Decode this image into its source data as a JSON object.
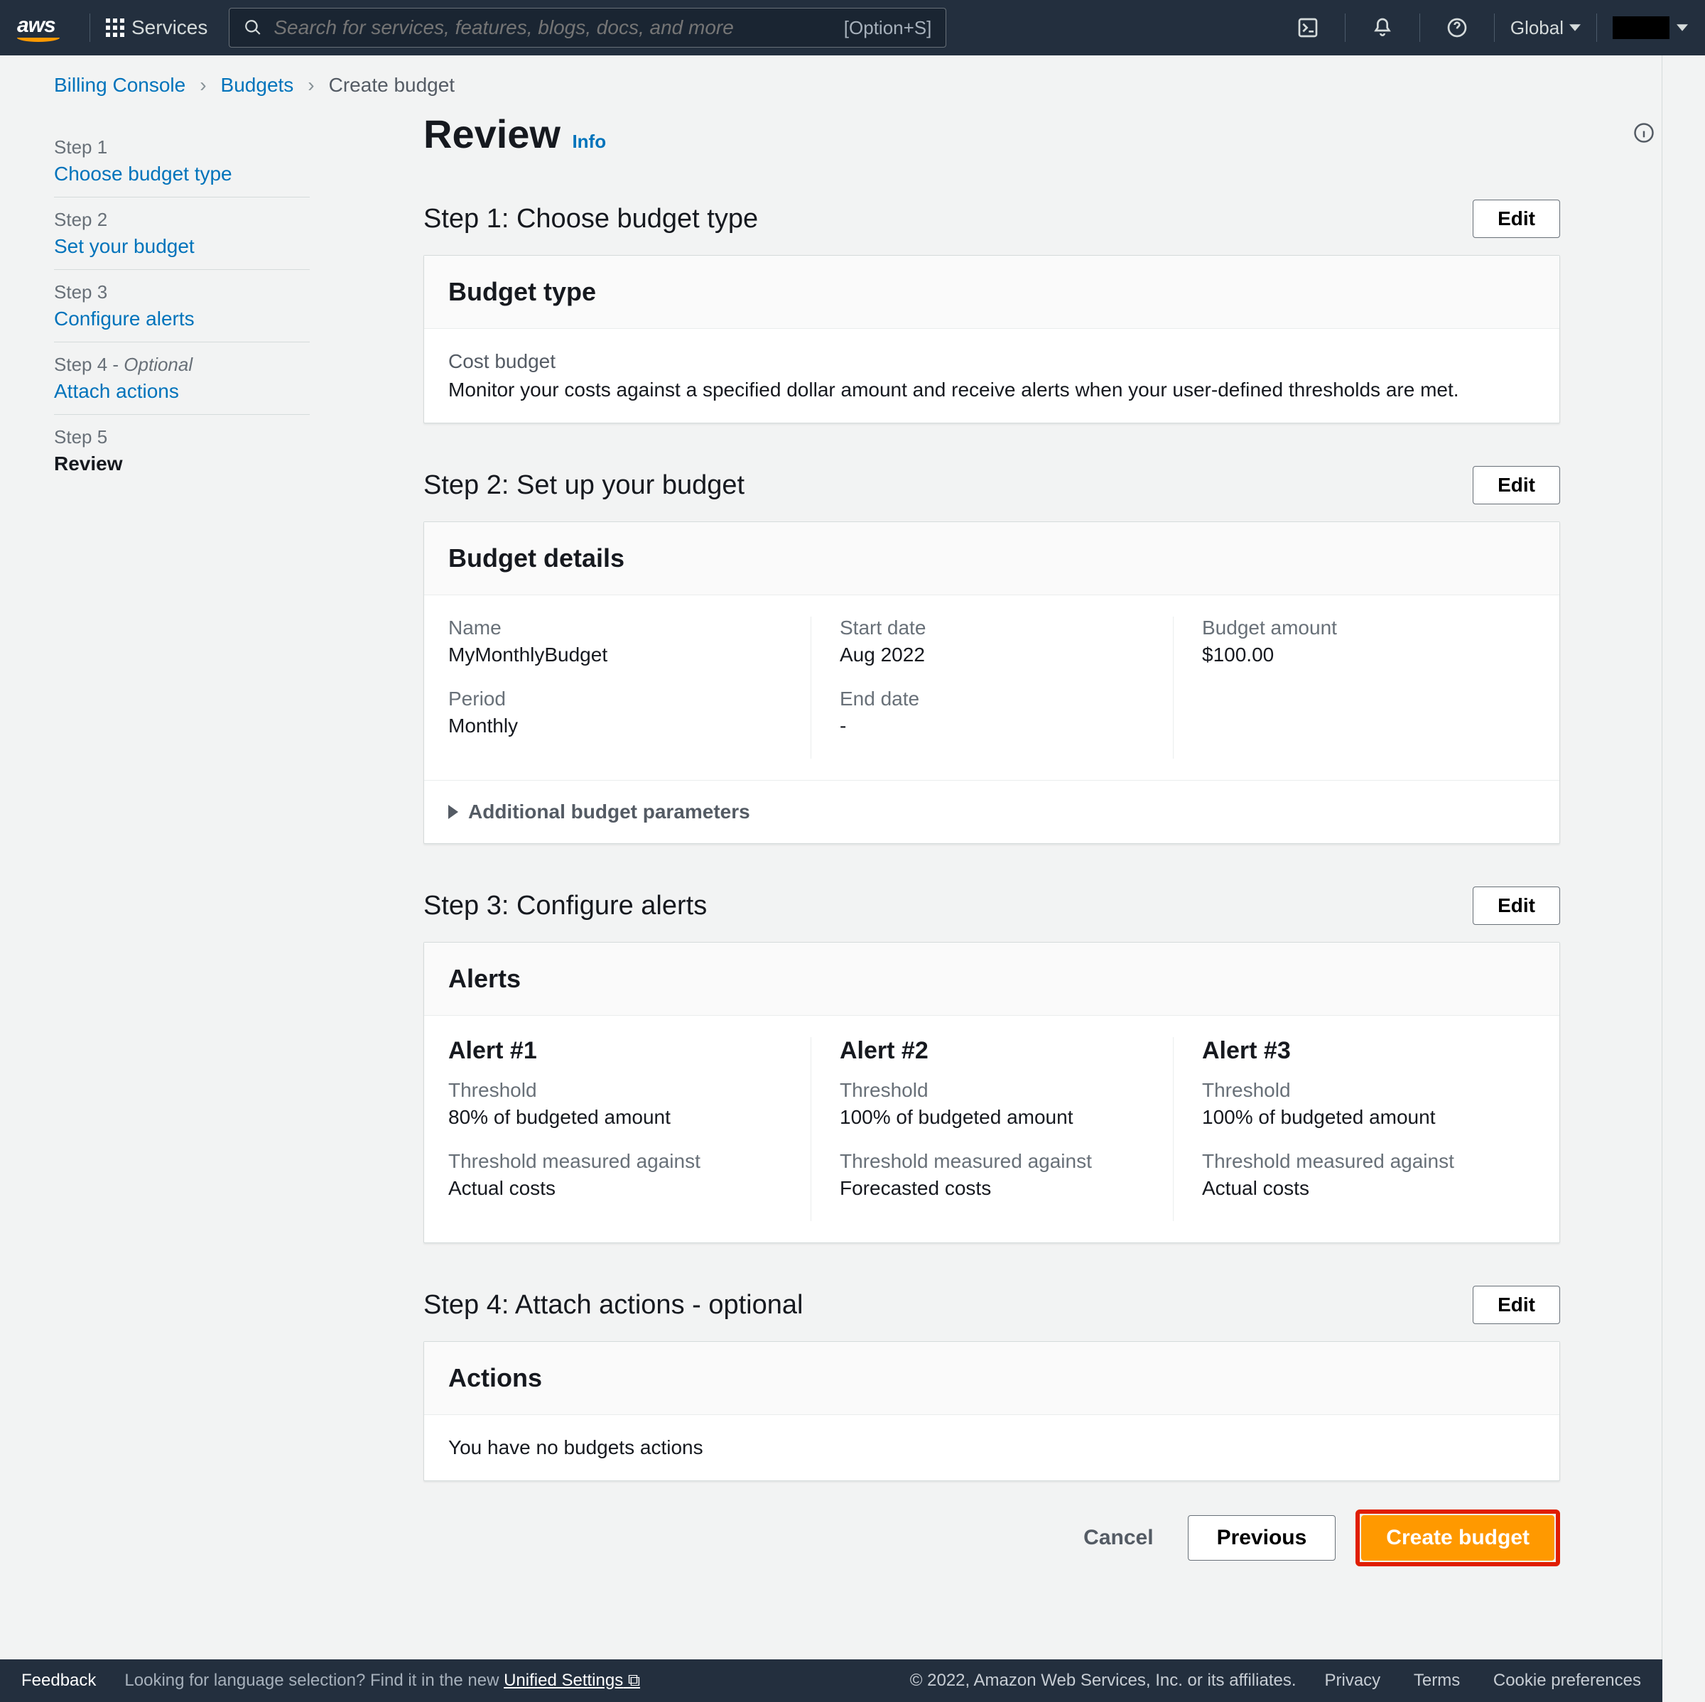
{
  "topnav": {
    "logo": "aws",
    "services": "Services",
    "search_placeholder": "Search for services, features, blogs, docs, and more",
    "search_shortcut": "[Option+S]",
    "region": "Global"
  },
  "breadcrumbs": {
    "a": "Billing Console",
    "b": "Budgets",
    "c": "Create budget"
  },
  "side_steps": [
    {
      "num": "Step 1",
      "title": "Choose budget type",
      "link": true
    },
    {
      "num": "Step 2",
      "title": "Set your budget",
      "link": true
    },
    {
      "num": "Step 3",
      "title": "Configure alerts",
      "link": true
    },
    {
      "num": "Step 4 - ",
      "optional": "Optional",
      "title": "Attach actions",
      "link": true
    },
    {
      "num": "Step 5",
      "title": "Review",
      "active": true
    }
  ],
  "page_title": "Review",
  "info_label": "Info",
  "edit_label": "Edit",
  "step1": {
    "heading": "Step 1: Choose budget type",
    "panel_title": "Budget type",
    "type_name": "Cost budget",
    "type_desc": "Monitor your costs against a specified dollar amount and receive alerts when your user-defined thresholds are met."
  },
  "step2": {
    "heading": "Step 2: Set up your budget",
    "panel_title": "Budget details",
    "fields": {
      "name_label": "Name",
      "name_value": "MyMonthlyBudget",
      "period_label": "Period",
      "period_value": "Monthly",
      "start_label": "Start date",
      "start_value": "Aug 2022",
      "end_label": "End date",
      "end_value": "-",
      "amount_label": "Budget amount",
      "amount_value": "$100.00"
    },
    "expander": "Additional budget parameters"
  },
  "step3": {
    "heading": "Step 3: Configure alerts",
    "panel_title": "Alerts",
    "th_label": "Threshold",
    "tma_label": "Threshold measured against",
    "alerts": [
      {
        "title": "Alert #1",
        "threshold": "80% of budgeted amount",
        "measured": "Actual costs"
      },
      {
        "title": "Alert #2",
        "threshold": "100% of budgeted amount",
        "measured": "Forecasted costs"
      },
      {
        "title": "Alert #3",
        "threshold": "100% of budgeted amount",
        "measured": "Actual costs"
      }
    ]
  },
  "step4": {
    "heading": "Step 4: Attach actions - optional",
    "panel_title": "Actions",
    "empty": "You have no budgets actions"
  },
  "buttons": {
    "cancel": "Cancel",
    "previous": "Previous",
    "create": "Create budget"
  },
  "footer": {
    "feedback": "Feedback",
    "lang_pre": "Looking for language selection? Find it in the new ",
    "lang_link": "Unified Settings",
    "copyright": "© 2022, Amazon Web Services, Inc. or its affiliates.",
    "privacy": "Privacy",
    "terms": "Terms",
    "cookies": "Cookie preferences"
  }
}
